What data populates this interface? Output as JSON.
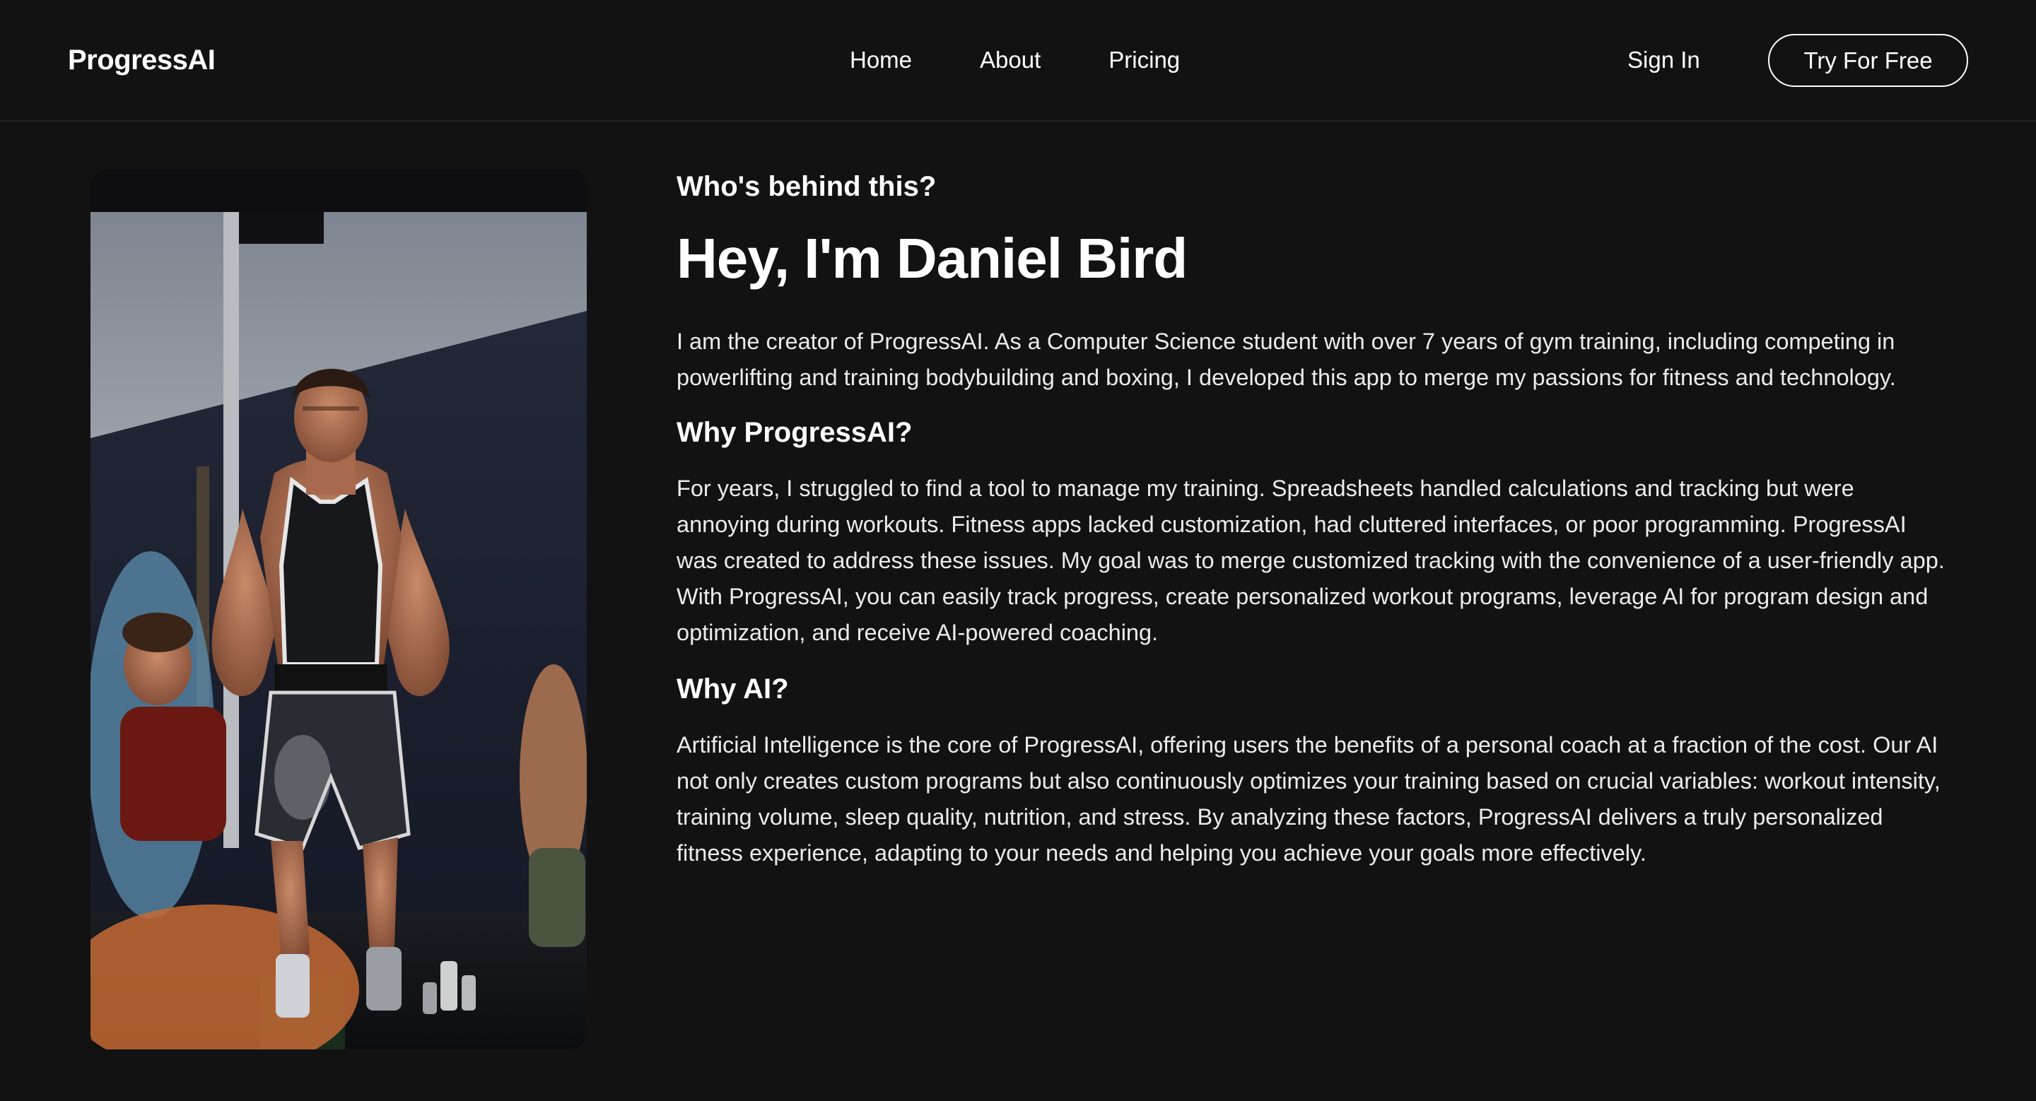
{
  "brand": {
    "name": "ProgressAI"
  },
  "nav": {
    "links": [
      {
        "label": "Home"
      },
      {
        "label": "About"
      },
      {
        "label": "Pricing"
      }
    ],
    "sign_in_label": "Sign In",
    "cta_label": "Try For Free"
  },
  "about": {
    "eyebrow": "Who's behind this?",
    "title": "Hey, I'm Daniel Bird",
    "intro": "I am the creator of ProgressAI. As a Computer Science student with over 7 years of gym training, including competing in powerlifting and training bodybuilding and boxing, I developed this app to merge my passions for fitness and technology.",
    "why_progressai_heading": "Why ProgressAI?",
    "why_progressai_text": "For years, I struggled to find a tool to manage my training. Spreadsheets handled calculations and tracking but were annoying during workouts. Fitness apps lacked customization, had cluttered interfaces, or poor programming. ProgressAI was created to address these issues. My goal was to merge customized tracking with the convenience of a user-friendly app. With ProgressAI, you can easily track progress, create personalized workout programs, leverage AI for program design and optimization, and receive AI-powered coaching.",
    "why_ai_heading": "Why AI?",
    "why_ai_text": "Artificial Intelligence is the core of ProgressAI, offering users the benefits of a personal coach at a fraction of the cost. Our AI not only creates custom programs but also continuously optimizes your training based on crucial variables: workout intensity, training volume, sleep quality, nutrition, and stress. By analyzing these factors, ProgressAI delivers a truly personalized fitness experience, adapting to your needs and helping you achieve your goals more effectively."
  },
  "colors": {
    "background": "#121212",
    "text": "#ffffff",
    "body_text": "#ececec"
  }
}
